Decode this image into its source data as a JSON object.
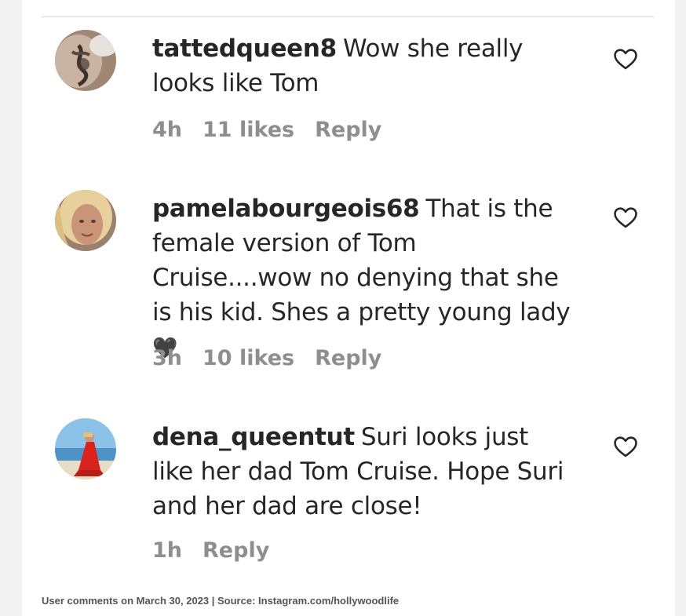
{
  "comments": [
    {
      "username": "tattedqueen8",
      "text": "Wow she really looks like Tom",
      "time": "4h",
      "likes": "11 likes",
      "reply": "Reply",
      "avatar_icon": "user-avatar-tattoo"
    },
    {
      "username": "pamelabourgeois68",
      "text": "That is the female version of Tom Cruise....wow no denying that she is his kid. Shes a pretty young lady",
      "emoji": "🖤",
      "time": "3h",
      "likes": "10 likes",
      "reply": "Reply",
      "avatar_icon": "user-avatar-portrait"
    },
    {
      "username": "dena_queentut",
      "text": "Suri looks just like her dad Tom Cruise. Hope Suri and her dad are close!",
      "time": "1h",
      "reply": "Reply",
      "avatar_icon": "user-avatar-beach"
    }
  ],
  "like_icon": "heart-outline-icon",
  "caption": "User comments on March 30, 2023 | Source: Instagram.com/hollywoodlife",
  "colors": {
    "text": "#262626",
    "meta": "#8e8e8e",
    "divider": "#dbdbdb"
  }
}
